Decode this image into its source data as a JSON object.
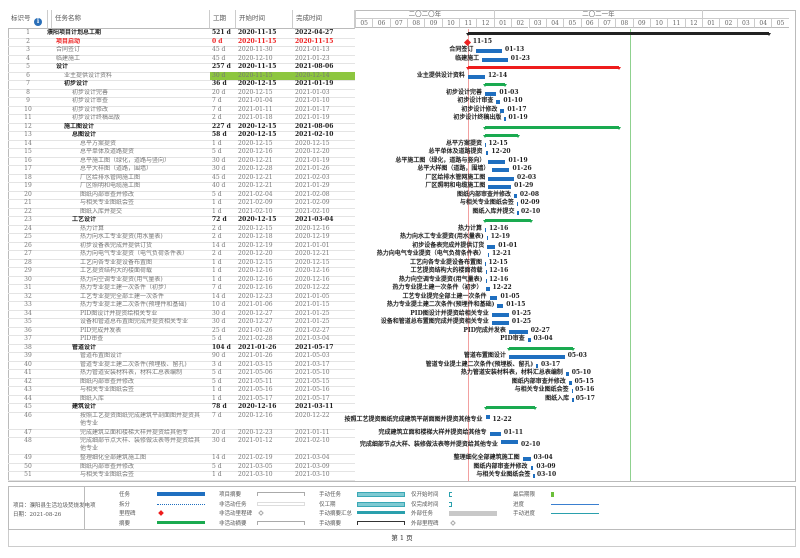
{
  "table": {
    "headers": {
      "id": "标识号",
      "name": "任务名称",
      "duration": "工期",
      "start": "开始时间",
      "finish": "完成时间"
    },
    "rows": [
      {
        "id": "1",
        "name": "濮阳项目计划总工期",
        "duration": "521 d",
        "start": "2020-11-15",
        "finish": "2022-04-27",
        "level": 0,
        "type": "project"
      },
      {
        "id": "2",
        "name": "项目启动",
        "duration": "0 d",
        "start": "2020-11-15",
        "finish": "2020-11-15",
        "level": 1,
        "type": "milestone"
      },
      {
        "id": "3",
        "name": "合同签订",
        "duration": "45 d",
        "start": "2020-11-30",
        "finish": "2021-01-13",
        "level": 1,
        "type": "task"
      },
      {
        "id": "4",
        "name": "临建施工",
        "duration": "45 d",
        "start": "2020-12-10",
        "finish": "2021-01-23",
        "level": 1,
        "type": "task"
      },
      {
        "id": "5",
        "name": "设计",
        "duration": "257 d",
        "start": "2020-11-15",
        "finish": "2021-08-06",
        "level": 1,
        "type": "critical-summary"
      },
      {
        "id": "6",
        "name": "业主提供设计资料",
        "duration": "30 d",
        "start": "2020-11-15",
        "finish": "2020-12-14",
        "level": 2,
        "type": "task",
        "highlight": true
      },
      {
        "id": "7",
        "name": "初步设计",
        "duration": "36 d",
        "start": "2020-12-15",
        "finish": "2021-01-19",
        "level": 2,
        "type": "summary"
      },
      {
        "id": "8",
        "name": "初步设计完善",
        "duration": "20 d",
        "start": "2020-12-15",
        "finish": "2021-01-03",
        "level": 3,
        "type": "task"
      },
      {
        "id": "9",
        "name": "初步设计审查",
        "duration": "7 d",
        "start": "2021-01-04",
        "finish": "2021-01-10",
        "level": 3,
        "type": "task"
      },
      {
        "id": "10",
        "name": "初步设计修改",
        "duration": "7 d",
        "start": "2021-01-11",
        "finish": "2021-01-17",
        "level": 3,
        "type": "task"
      },
      {
        "id": "11",
        "name": "初步设计终稿出版",
        "duration": "2 d",
        "start": "2021-01-18",
        "finish": "2021-01-19",
        "level": 3,
        "type": "task"
      },
      {
        "id": "12",
        "name": "施工图设计",
        "duration": "227 d",
        "start": "2020-12-15",
        "finish": "2021-08-06",
        "level": 2,
        "type": "summary"
      },
      {
        "id": "13",
        "name": "总图设计",
        "duration": "58 d",
        "start": "2020-12-15",
        "finish": "2021-02-10",
        "level": 3,
        "type": "summary"
      },
      {
        "id": "14",
        "name": "总平方案提资",
        "duration": "1 d",
        "start": "2020-12-15",
        "finish": "2020-12-15",
        "level": 4,
        "type": "task"
      },
      {
        "id": "15",
        "name": "总平单体及道路提资",
        "duration": "5 d",
        "start": "2020-12-16",
        "finish": "2020-12-20",
        "level": 4,
        "type": "task"
      },
      {
        "id": "16",
        "name": "总平施工图（绿化，道路与竖向）",
        "duration": "30 d",
        "start": "2020-12-21",
        "finish": "2021-01-19",
        "level": 4,
        "type": "task"
      },
      {
        "id": "17",
        "name": "总平大样图（道路，围墙）",
        "duration": "30 d",
        "start": "2020-12-28",
        "finish": "2021-01-26",
        "level": 4,
        "type": "task"
      },
      {
        "id": "18",
        "name": "厂区给排水管网施工图",
        "duration": "45 d",
        "start": "2020-12-21",
        "finish": "2021-02-03",
        "level": 4,
        "type": "task"
      },
      {
        "id": "19",
        "name": "厂区照明和电缆施工图",
        "duration": "40 d",
        "start": "2020-12-21",
        "finish": "2021-01-29",
        "level": 4,
        "type": "task"
      },
      {
        "id": "20",
        "name": "图纸内部审查并修改",
        "duration": "5 d",
        "start": "2021-02-04",
        "finish": "2021-02-08",
        "level": 4,
        "type": "task"
      },
      {
        "id": "21",
        "name": "与相关专业图纸会签",
        "duration": "1 d",
        "start": "2021-02-09",
        "finish": "2021-02-09",
        "level": 4,
        "type": "task"
      },
      {
        "id": "22",
        "name": "图纸入库并提交",
        "duration": "1 d",
        "start": "2021-02-10",
        "finish": "2021-02-10",
        "level": 4,
        "type": "task"
      },
      {
        "id": "23",
        "name": "工艺设计",
        "duration": "72 d",
        "start": "2020-12-15",
        "finish": "2021-03-04",
        "level": 3,
        "type": "summary"
      },
      {
        "id": "24",
        "name": "热力计算",
        "duration": "2 d",
        "start": "2020-12-15",
        "finish": "2020-12-16",
        "level": 4,
        "type": "task"
      },
      {
        "id": "25",
        "name": "热力向水工专业提资(用水量表)",
        "duration": "2 d",
        "start": "2020-12-18",
        "finish": "2020-12-19",
        "level": 4,
        "type": "task"
      },
      {
        "id": "26",
        "name": "初步设备表完成并提供订货",
        "duration": "14 d",
        "start": "2020-12-19",
        "finish": "2021-01-01",
        "level": 4,
        "type": "task"
      },
      {
        "id": "27",
        "name": "热力向电气专业提资（电气负荷条件表）",
        "duration": "2 d",
        "start": "2020-12-20",
        "finish": "2020-12-21",
        "level": 4,
        "type": "task"
      },
      {
        "id": "28",
        "name": "工艺向各专业提设备布置图",
        "duration": "1 d",
        "start": "2020-12-15",
        "finish": "2020-12-15",
        "level": 4,
        "type": "task"
      },
      {
        "id": "29",
        "name": "工艺提资结构大的楼面荷载",
        "duration": "1 d",
        "start": "2020-12-16",
        "finish": "2020-12-16",
        "level": 4,
        "type": "task"
      },
      {
        "id": "30",
        "name": "热力向空调专业提资(用气量表)",
        "duration": "1 d",
        "start": "2020-12-16",
        "finish": "2020-12-16",
        "level": 4,
        "type": "task"
      },
      {
        "id": "31",
        "name": "热力专业提土建一次条件（初步）",
        "duration": "7 d",
        "start": "2020-12-16",
        "finish": "2020-12-22",
        "level": 4,
        "type": "task"
      },
      {
        "id": "32",
        "name": "工艺专业提完全部土建一次条件",
        "duration": "14 d",
        "start": "2020-12-23",
        "finish": "2021-01-05",
        "level": 4,
        "type": "task"
      },
      {
        "id": "33",
        "name": "热力专业提土建二次条件(预埋件和基础)",
        "duration": "10 d",
        "start": "2021-01-06",
        "finish": "2021-01-15",
        "level": 4,
        "type": "task"
      },
      {
        "id": "34",
        "name": "PID图设计并提资给相关专业",
        "duration": "30 d",
        "start": "2020-12-27",
        "finish": "2021-01-25",
        "level": 4,
        "type": "task"
      },
      {
        "id": "35",
        "name": "设备和管道总布置图完成并提资相关专业",
        "duration": "30 d",
        "start": "2020-12-27",
        "finish": "2021-01-25",
        "level": 4,
        "type": "task"
      },
      {
        "id": "36",
        "name": "PID完成并发表",
        "duration": "25 d",
        "start": "2021-01-26",
        "finish": "2021-02-27",
        "level": 4,
        "type": "task"
      },
      {
        "id": "37",
        "name": "PID审查",
        "duration": "5 d",
        "start": "2021-02-28",
        "finish": "2021-03-04",
        "level": 4,
        "type": "task"
      },
      {
        "id": "38",
        "name": "管道设计",
        "duration": "104 d",
        "start": "2021-01-26",
        "finish": "2021-05-17",
        "level": 3,
        "type": "summary"
      },
      {
        "id": "39",
        "name": "管道布置图设计",
        "duration": "90 d",
        "start": "2021-01-26",
        "finish": "2021-05-03",
        "level": 4,
        "type": "task"
      },
      {
        "id": "40",
        "name": "管道专业提土建二次条件(预埋板、留孔)",
        "duration": "3 d",
        "start": "2021-03-15",
        "finish": "2021-03-17",
        "level": 4,
        "type": "task"
      },
      {
        "id": "41",
        "name": "热力管道安装材料表，材料汇总表编制",
        "duration": "5 d",
        "start": "2021-05-06",
        "finish": "2021-05-10",
        "level": 4,
        "type": "task"
      },
      {
        "id": "42",
        "name": "图纸内部审查并修改",
        "duration": "5 d",
        "start": "2021-05-11",
        "finish": "2021-05-15",
        "level": 4,
        "type": "task"
      },
      {
        "id": "43",
        "name": "与相关专业图纸会签",
        "duration": "1 d",
        "start": "2021-05-16",
        "finish": "2021-05-16",
        "level": 4,
        "type": "task"
      },
      {
        "id": "44",
        "name": "图纸入库",
        "duration": "1 d",
        "start": "2021-05-17",
        "finish": "2021-05-17",
        "level": 4,
        "type": "task"
      },
      {
        "id": "45",
        "name": "建筑设计",
        "duration": "78 d",
        "start": "2020-12-16",
        "finish": "2021-03-11",
        "level": 3,
        "type": "summary"
      },
      {
        "id": "46",
        "name": "按照工艺提资图纸完成建筑平剖面图并提资其他专业",
        "duration": "7 d",
        "start": "2020-12-16",
        "finish": "2020-12-22",
        "level": 4,
        "type": "task",
        "tall": true
      },
      {
        "id": "47",
        "name": "完成建筑立面和楼梯大样并提资给其他专",
        "duration": "20 d",
        "start": "2020-12-23",
        "finish": "2021-01-11",
        "level": 4,
        "type": "task"
      },
      {
        "id": "48",
        "name": "完成细部节点大样、装修做法表等并提资给其他专业",
        "duration": "30 d",
        "start": "2021-01-12",
        "finish": "2021-02-10",
        "level": 4,
        "type": "task",
        "tall": true
      },
      {
        "id": "49",
        "name": "整理细化全部建筑施工图",
        "duration": "14 d",
        "start": "2021-02-19",
        "finish": "2021-03-04",
        "level": 4,
        "type": "task"
      },
      {
        "id": "50",
        "name": "图纸内部审查并修改",
        "duration": "5 d",
        "start": "2021-03-05",
        "finish": "2021-03-09",
        "level": 4,
        "type": "task"
      },
      {
        "id": "51",
        "name": "与相关专业图纸会签",
        "duration": "1 d",
        "start": "2021-03-10",
        "finish": "2021-03-10",
        "level": 4,
        "type": "task"
      }
    ]
  },
  "timescale": {
    "years": [
      {
        "label": "二〇二〇年",
        "months": 8
      },
      {
        "label": "二〇二一年",
        "months": 12
      },
      {
        "label": "",
        "months": 5
      }
    ],
    "months": [
      "05",
      "06",
      "07",
      "08",
      "09",
      "10",
      "11",
      "12",
      "01",
      "02",
      "03",
      "04",
      "05",
      "06",
      "07",
      "08",
      "09",
      "10",
      "11",
      "12",
      "01",
      "02",
      "03",
      "04",
      "05"
    ],
    "start": "2020-05-01",
    "status_date": "2021-08-26"
  },
  "colors": {
    "task": "#1f6fc0",
    "summary": "#1aaa50",
    "critical": "#ee1c1c",
    "project": "#222222",
    "milestone": "#ee1c1c",
    "highlight": "#8dc63f",
    "status_line": "#8fd18f"
  },
  "legend": {
    "project": "项目：濮阳县生活垃圾焚烧发电项",
    "date": "日期：2021-08-26",
    "items": [
      {
        "label": "任务",
        "swatch": "task"
      },
      {
        "label": "拆分",
        "swatch": "split"
      },
      {
        "label": "里程碑",
        "swatch": "milestone"
      },
      {
        "label": "摘要",
        "swatch": "summary"
      },
      {
        "label": "项目摘要",
        "swatch": "project"
      },
      {
        "label": "非活动任务",
        "swatch": "inactive"
      },
      {
        "label": "非活动里程碑",
        "swatch": "inactive-ms"
      },
      {
        "label": "非活动摘要",
        "swatch": "inactive-sum"
      },
      {
        "label": "手动任务",
        "swatch": "manual"
      },
      {
        "label": "仅工期",
        "swatch": "duration-only"
      },
      {
        "label": "手动摘要汇总",
        "swatch": "manual-rollup"
      },
      {
        "label": "手动摘要",
        "swatch": "manual-sum"
      },
      {
        "label": "仅开始时间",
        "swatch": "start-only"
      },
      {
        "label": "仅完成时间",
        "swatch": "finish-only"
      },
      {
        "label": "外部任务",
        "swatch": "external"
      },
      {
        "label": "外部里程碑",
        "swatch": "external-ms"
      },
      {
        "label": "最后期限",
        "swatch": "deadline"
      },
      {
        "label": "进度",
        "swatch": "progress"
      },
      {
        "label": "手动进度",
        "swatch": "manual-progress"
      }
    ]
  },
  "footer": {
    "page": "第 1 页"
  }
}
